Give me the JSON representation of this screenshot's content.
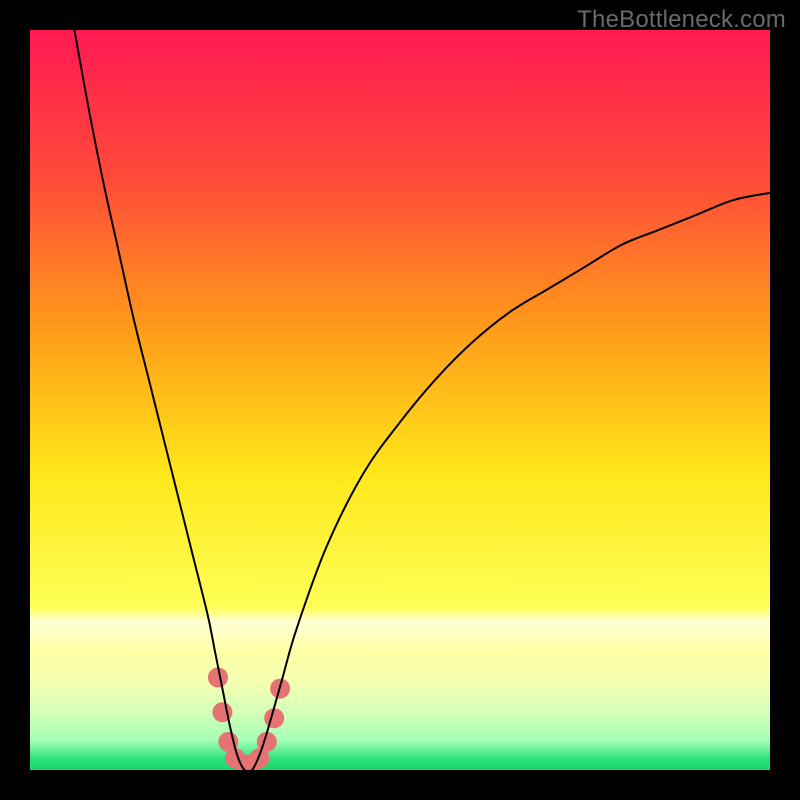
{
  "watermark": "TheBottleneck.com",
  "chart_data": {
    "type": "line",
    "title": "",
    "xlabel": "",
    "ylabel": "",
    "xlim": [
      0,
      100
    ],
    "ylim": [
      0,
      100
    ],
    "grid": false,
    "legend": false,
    "background": {
      "type": "vertical-gradient",
      "stops": [
        {
          "pos": 0.0,
          "color": "#ff1a52"
        },
        {
          "pos": 0.2,
          "color": "#ff4a3a"
        },
        {
          "pos": 0.4,
          "color": "#ff9a1a"
        },
        {
          "pos": 0.6,
          "color": "#ffe71a"
        },
        {
          "pos": 0.78,
          "color": "#ffff58"
        },
        {
          "pos": 0.8,
          "color": "#ffffd6"
        },
        {
          "pos": 0.84,
          "color": "#ffffa4"
        },
        {
          "pos": 0.88,
          "color": "#f4ffb0"
        },
        {
          "pos": 0.92,
          "color": "#d6ffb8"
        },
        {
          "pos": 0.96,
          "color": "#a4ffb6"
        },
        {
          "pos": 0.985,
          "color": "#2de37a"
        },
        {
          "pos": 1.0,
          "color": "#17d66a"
        }
      ]
    },
    "series": [
      {
        "name": "bottleneck-curve",
        "color": "#000000",
        "x": [
          6,
          8,
          10,
          12,
          14,
          16,
          18,
          20,
          22,
          24,
          25,
          26,
          27,
          28,
          29,
          30,
          31,
          32,
          34,
          36,
          40,
          45,
          50,
          55,
          60,
          65,
          70,
          75,
          80,
          85,
          90,
          95,
          100
        ],
        "y": [
          100,
          89,
          79,
          70,
          61,
          53,
          45,
          37,
          29,
          21,
          16,
          11,
          6,
          2,
          0,
          0,
          2,
          5,
          12,
          19,
          30,
          40,
          47,
          53,
          58,
          62,
          65,
          68,
          71,
          73,
          75,
          77,
          78
        ]
      }
    ],
    "marker_cluster": {
      "name": "optimal-zone",
      "color": "#e57373",
      "radius": 10,
      "points": [
        {
          "x": 25.4,
          "y": 12.5
        },
        {
          "x": 26.0,
          "y": 7.8
        },
        {
          "x": 26.8,
          "y": 3.8
        },
        {
          "x": 27.7,
          "y": 1.6
        },
        {
          "x": 28.8,
          "y": 0.8
        },
        {
          "x": 29.9,
          "y": 0.8
        },
        {
          "x": 31.0,
          "y": 1.6
        },
        {
          "x": 32.0,
          "y": 3.8
        },
        {
          "x": 33.0,
          "y": 7.0
        },
        {
          "x": 33.8,
          "y": 11.0
        }
      ]
    }
  }
}
